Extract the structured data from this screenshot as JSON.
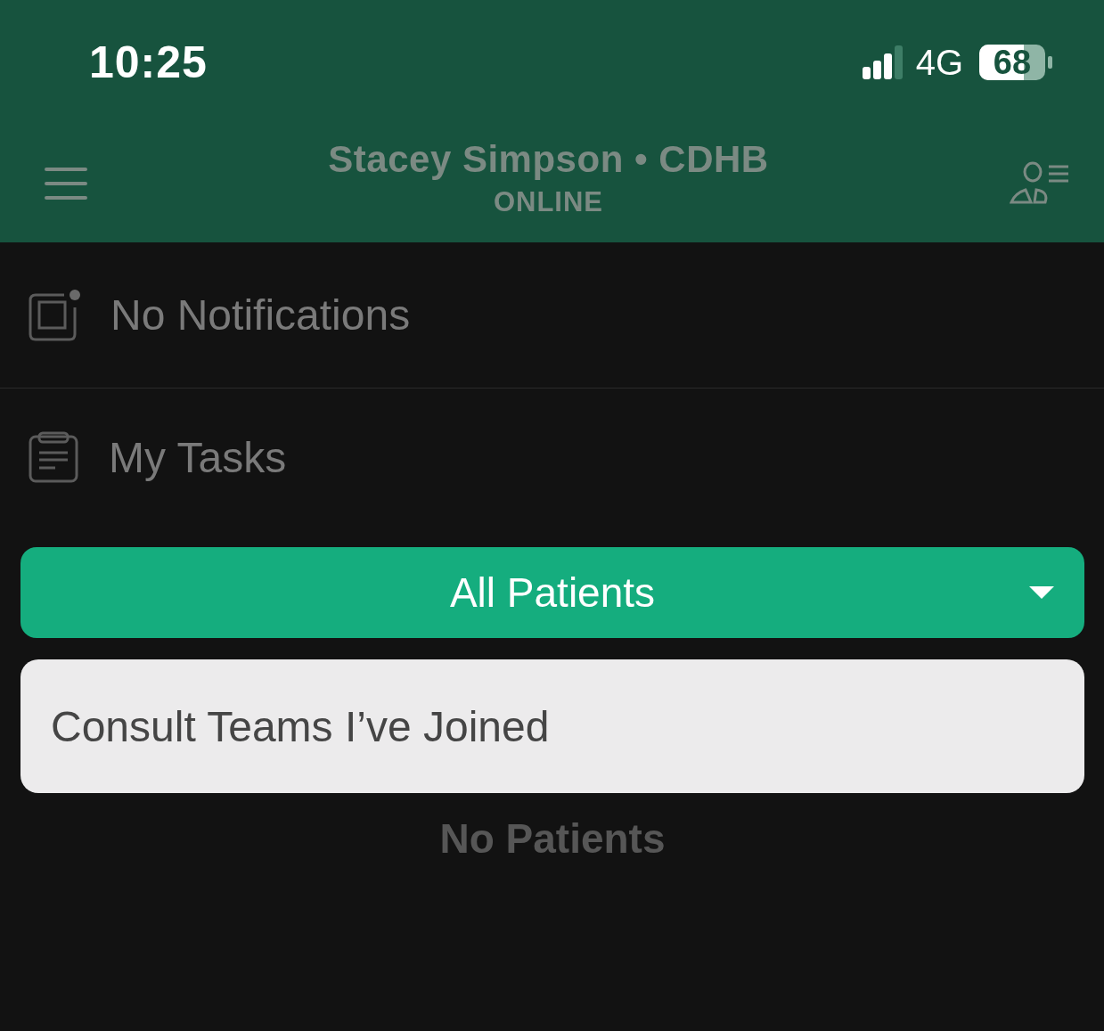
{
  "status_bar": {
    "time": "10:25",
    "network": "4G",
    "battery": "68"
  },
  "header": {
    "title": "Stacey Simpson • CDHB",
    "subtitle": "ONLINE"
  },
  "rows": [
    {
      "kind": "notifications",
      "label": "No Notifications"
    },
    {
      "kind": "tasks",
      "label": "My Tasks"
    }
  ],
  "filter": {
    "label": "All Patients",
    "expanded": true
  },
  "options": [
    {
      "label": "Consult Teams I’ve Joined"
    }
  ],
  "empty_message": "No Patients"
}
